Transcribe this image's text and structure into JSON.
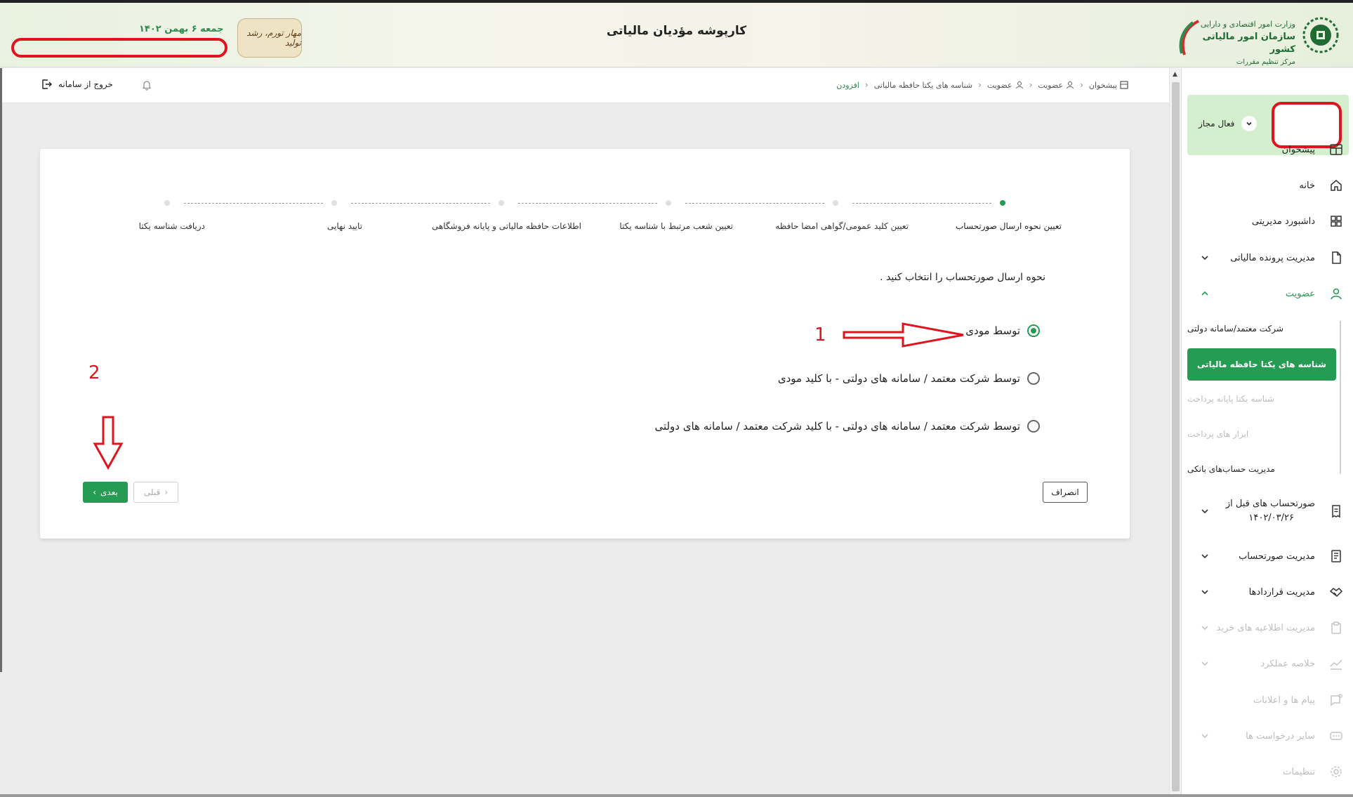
{
  "header": {
    "title": "کارپوشه مؤدیان مالیاتی",
    "date": "جمعه ۶ بهمن ۱۴۰۲",
    "org_line1": "وزارت امور اقتصادی و دارایی",
    "org_line2": "سازمان امور مالیاتی کشور",
    "org_line3": "مرکز تنظیم مقررات",
    "slogan": "مهار تورم، رشد تولید"
  },
  "toolbar": {
    "logout_label": "خروج از سامانه"
  },
  "breadcrumb": {
    "items": [
      "پیشخوان",
      "عضویت",
      "عضویت",
      "شناسه های یکتا حافظه مالیاتی",
      "افزودن"
    ]
  },
  "sidebar": {
    "status": "فعال مجاز",
    "items": [
      {
        "label": "پیشخوان",
        "icon": "dashboard-icon"
      },
      {
        "label": "خانه",
        "icon": "home-icon"
      },
      {
        "label": "داشبورد مدیریتی",
        "icon": "grid-icon"
      },
      {
        "label": "مدیریت پرونده مالیاتی",
        "icon": "file-icon"
      },
      {
        "label": "عضویت",
        "icon": "user-icon"
      },
      {
        "label": "صورتحساب های قبل از",
        "label2": "۱۴۰۲/۰۳/۲۶",
        "icon": "receipt-icon"
      },
      {
        "label": "مدیریت صورتحساب",
        "icon": "invoice-icon"
      },
      {
        "label": "مدیریت قراردادها",
        "icon": "handshake-icon"
      },
      {
        "label": "مدیریت اطلاعیه های خرید",
        "icon": "clipboard-icon"
      },
      {
        "label": "خلاصه عملکرد",
        "icon": "chart-icon"
      },
      {
        "label": "پیام ها و اعلانات",
        "icon": "message-icon"
      },
      {
        "label": "سایر درخواست ها",
        "icon": "more-icon"
      },
      {
        "label": "تنظیمات",
        "icon": "gear-icon"
      }
    ],
    "subitems": [
      {
        "label": "شرکت معتمد/سامانه دولتی"
      },
      {
        "label": "شناسه های یکتا حافظه مالیاتی"
      },
      {
        "label": "شناسه یکتا پایانه پرداخت"
      },
      {
        "label": "ابزار های پرداخت"
      },
      {
        "label": "مدیریت حساب‌های بانکی"
      }
    ]
  },
  "stepper": {
    "steps": [
      "تعیین نحوه ارسال صورتحساب",
      "تعیین کلید عمومی/گواهی امضا حافظه",
      "تعیین شعب مرتبط با شناسه یکتا",
      "اطلاعات حافظه مالیاتی و پایانه فروشگاهی",
      "تایید نهایی",
      "دریافت شناسه یکتا"
    ]
  },
  "form": {
    "prompt": "نحوه ارسال صورتحساب را انتخاب کنید .",
    "options": [
      "توسط مودی",
      "توسط شرکت معتمد / سامانه های دولتی - با کلید مودی",
      "توسط شرکت معتمد / سامانه های دولتی - با کلید شرکت معتمد / سامانه های دولتی"
    ],
    "selected_index": 0,
    "cancel_label": "انصراف",
    "next_label": "بعدی",
    "prev_label": "قبلی"
  },
  "annotations": {
    "one": "1",
    "two": "2"
  },
  "colors": {
    "accent": "#269b52",
    "annotation": "#e0141e",
    "status_bg": "#d3efcd"
  }
}
